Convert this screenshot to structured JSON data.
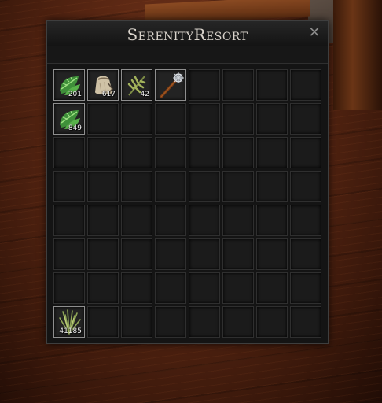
{
  "window": {
    "title": "SerenityResort",
    "close_symbol": "✕"
  },
  "inventory": {
    "columns": 8,
    "rows": 8,
    "items": [
      {
        "slot": 0,
        "icon": "green-leaves-icon",
        "count": "201"
      },
      {
        "slot": 1,
        "icon": "cloth-sack-icon",
        "count": "617"
      },
      {
        "slot": 2,
        "icon": "herb-sprig-icon",
        "count": "42"
      },
      {
        "slot": 3,
        "icon": "mace-weapon-icon",
        "count": ""
      },
      {
        "slot": 8,
        "icon": "green-leaves-icon",
        "count": "849"
      },
      {
        "slot": 56,
        "icon": "grass-bundle-icon",
        "count": "41185"
      }
    ]
  },
  "colors": {
    "slot_border_filled": "#8e8e8e",
    "title_text": "#d9d3cb",
    "leaf_green": "#3f8f3a",
    "herb_green": "#8a9a4a"
  }
}
